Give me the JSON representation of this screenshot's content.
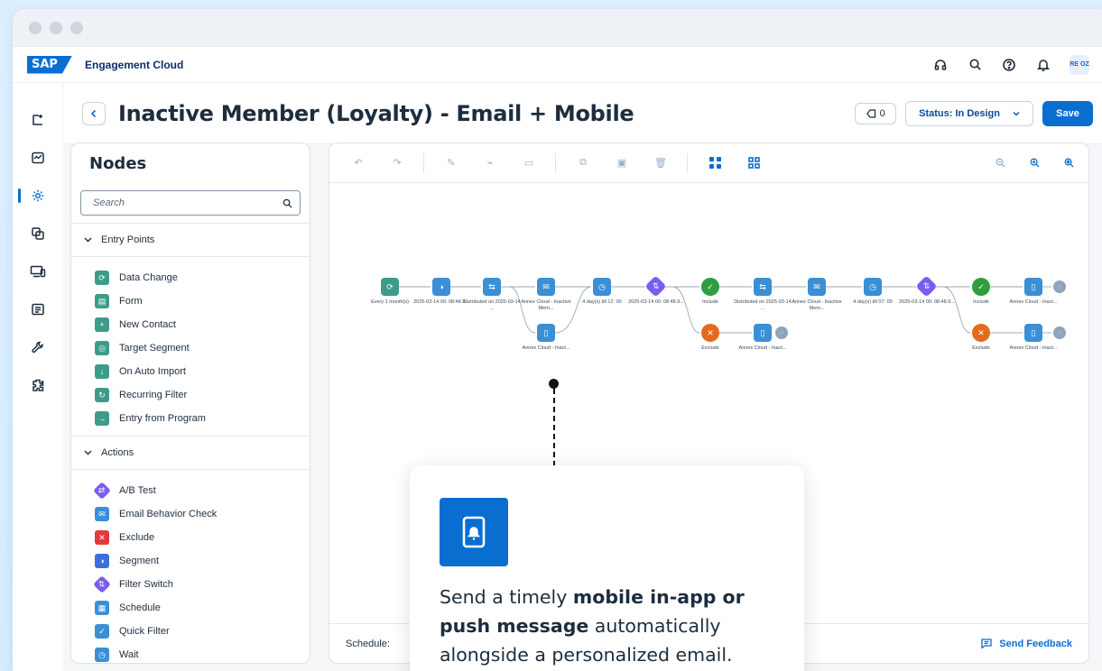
{
  "app": {
    "product_name": "Engagement Cloud",
    "logo_text": "SAP",
    "avatar_initials": "RE OZ"
  },
  "shell_icons": [
    "headset-icon",
    "search-icon",
    "help-icon",
    "bell-icon"
  ],
  "sidenav": {
    "items": [
      {
        "icon": "journey-icon",
        "active": false
      },
      {
        "icon": "analytics-icon",
        "active": false
      },
      {
        "icon": "settings-gear-icon",
        "active": true
      },
      {
        "icon": "content-icon",
        "active": false
      },
      {
        "icon": "devices-icon",
        "active": false
      },
      {
        "icon": "catalog-icon",
        "active": false
      },
      {
        "icon": "tools-icon",
        "active": false
      },
      {
        "icon": "extension-icon",
        "active": false
      }
    ]
  },
  "header": {
    "title": "Inactive Member (Loyalty) - Email + Mobile",
    "tag_count": "0",
    "status_label": "Status: In Design",
    "save_label": "Save"
  },
  "nodes_panel": {
    "title": "Nodes",
    "search_placeholder": "Search",
    "entry_points": {
      "label": "Entry Points",
      "items": [
        {
          "label": "Data Change",
          "color": "#3d9b8a"
        },
        {
          "label": "Form",
          "color": "#3d9b8a"
        },
        {
          "label": "New Contact",
          "color": "#3d9b8a"
        },
        {
          "label": "Target Segment",
          "color": "#3d9b8a"
        },
        {
          "label": "On Auto Import",
          "color": "#3d9b8a"
        },
        {
          "label": "Recurring Filter",
          "color": "#3d9b8a"
        },
        {
          "label": "Entry from Program",
          "color": "#3d9b8a"
        }
      ]
    },
    "actions": {
      "label": "Actions",
      "items": [
        {
          "label": "A/B Test",
          "color": "#7b5cf0"
        },
        {
          "label": "Email Behavior Check",
          "color": "#3b8fd6"
        },
        {
          "label": "Exclude",
          "color": "#e0393e"
        },
        {
          "label": "Segment",
          "color": "#3b6fe0"
        },
        {
          "label": "Filter Switch",
          "color": "#7b5cf0"
        },
        {
          "label": "Schedule",
          "color": "#3b8fd6"
        },
        {
          "label": "Quick Filter",
          "color": "#3b8fd6"
        },
        {
          "label": "Wait",
          "color": "#3b8fd6"
        }
      ]
    }
  },
  "canvas": {
    "footer_schedule": "Schedule:",
    "feedback_label": "Send Feedback",
    "flow_labels": {
      "n1": "Every 1 month(s)",
      "n2": "2025-03-14 00: 08:48.9...",
      "n3": "Distributed on 2025-03-14 ...",
      "n4": "Annex Cloud - Inactive Mem...",
      "n4b": "Annex Cloud - Inact...",
      "n5": "4 day(s) till 12: 00",
      "n6": "2025-03-14 00: 08:48.9...",
      "n7": "Include",
      "n7b": "Exclude",
      "n8": "Distributed on 2025-03-14 ...",
      "n8b": "Annex Cloud - Inact...",
      "n9": "Annex Cloud - Inactive Mem...",
      "n10": "4 day(s) till 07: 00",
      "n11": "2025-03-14 00: 08:48.9...",
      "n12": "Include",
      "n12b": "Exclude",
      "n13": "Annex Cloud - Inact...",
      "n13b": "Annex Cloud - Inact..."
    }
  },
  "callout": {
    "text_pre": "Send a timely ",
    "text_bold": "mobile in-app or push message",
    "text_post": " automatically alongside a personalized email.",
    "icon": "mobile-notification-icon"
  },
  "colors": {
    "accent": "#0a6ed1",
    "entry_green": "#3d9b8a",
    "flow_blue": "#3b8fd6",
    "flow_purple": "#7b5cf0",
    "include_green": "#2e9e3e",
    "exclude_orange": "#e46a1e"
  }
}
